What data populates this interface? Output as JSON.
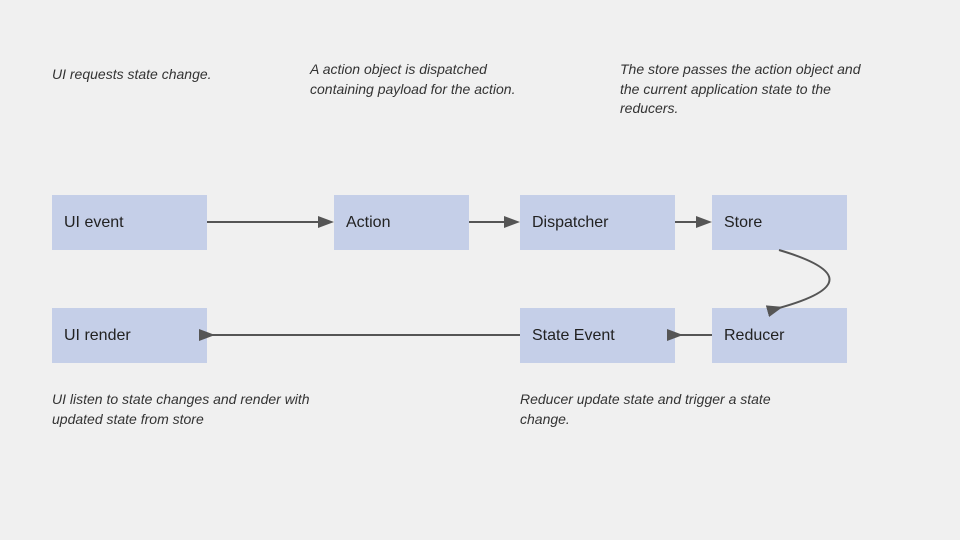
{
  "annotations": {
    "top_left": "UI requests state\nchange.",
    "top_middle": "A action object is dispatched\ncontaining payload for the\naction.",
    "top_right": "The store passes the action\nobject and the current\napplication state to the\nreducers.",
    "bottom_left": "UI listen to state changes and\nrender with updated state from\nstore",
    "bottom_middle": "Reducer update state and\ntrigger a state change."
  },
  "boxes": {
    "ui_event": "UI event",
    "action": "Action",
    "dispatcher": "Dispatcher",
    "store": "Store",
    "ui_render": "UI render",
    "state_event": "State Event",
    "reducer": "Reducer"
  },
  "colors": {
    "box_bg": "#c5cfe8",
    "bg": "#f0f0f0",
    "arrow": "#555"
  }
}
